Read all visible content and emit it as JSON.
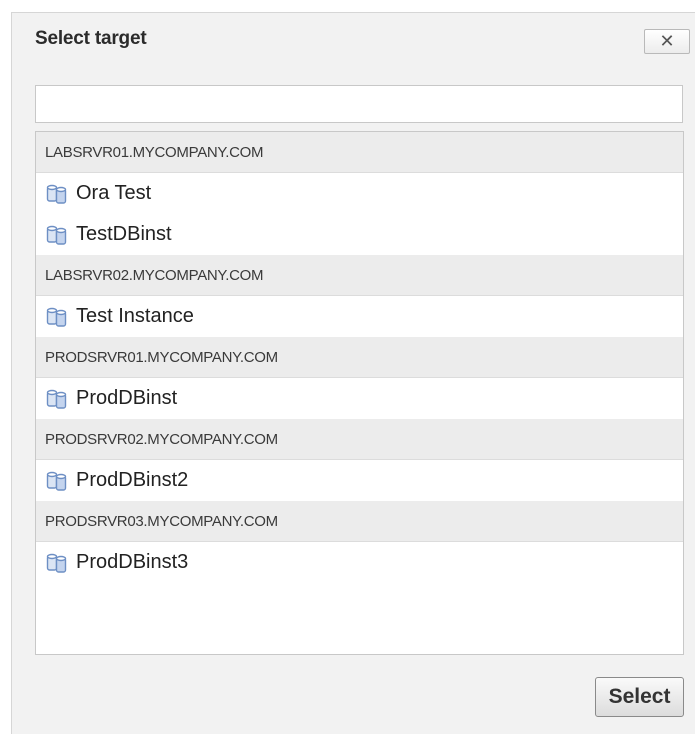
{
  "dialog": {
    "title": "Select target",
    "close_label": "✕"
  },
  "search": {
    "value": "",
    "placeholder": ""
  },
  "groups": [
    {
      "host": "LABSRVR01.MYCOMPANY.COM",
      "instances": [
        "Ora Test",
        "TestDBinst"
      ]
    },
    {
      "host": "LABSRVR02.MYCOMPANY.COM",
      "instances": [
        "Test Instance"
      ]
    },
    {
      "host": "PRODSRVR01.MYCOMPANY.COM",
      "instances": [
        "ProdDBinst"
      ]
    },
    {
      "host": "PRODSRVR02.MYCOMPANY.COM",
      "instances": [
        "ProdDBinst2"
      ]
    },
    {
      "host": "PRODSRVR03.MYCOMPANY.COM",
      "instances": [
        "ProdDBinst3"
      ]
    }
  ],
  "footer": {
    "select_label": "Select"
  },
  "icons": {
    "instance_icon": "database-instance-icon"
  },
  "colors": {
    "dialog_bg": "#f2f2f2",
    "group_header_bg": "#ececec",
    "icon_blue": "#6d8fc4"
  }
}
